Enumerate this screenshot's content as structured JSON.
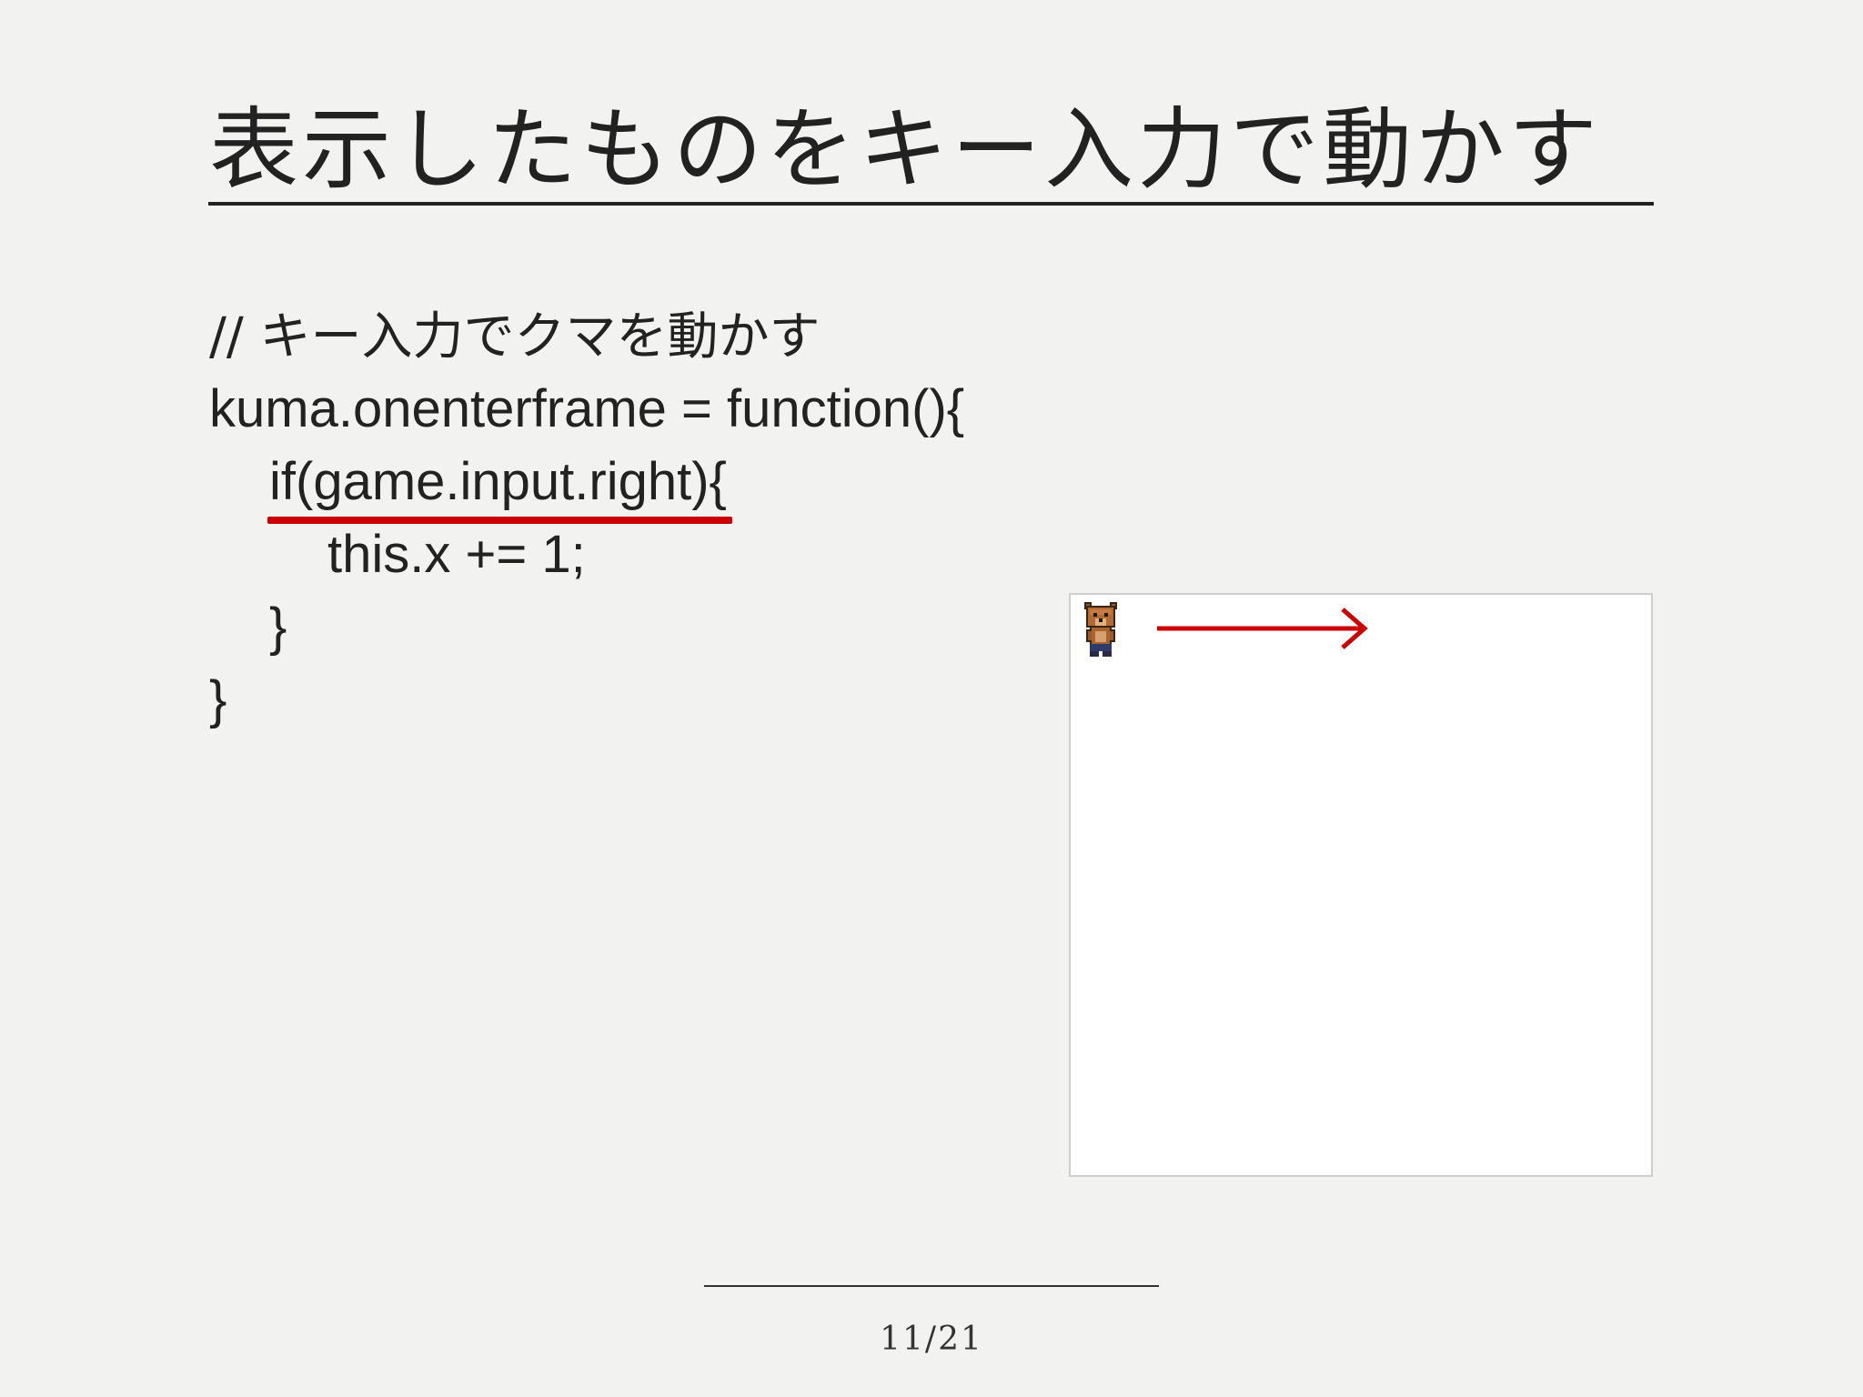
{
  "slide": {
    "title": "表示したものをキー入力で動かす",
    "page_number": "11/21"
  },
  "code": {
    "lines": [
      "// キー入力でクマを動かす",
      "kuma.onenterframe = function(){",
      "if(game.input.right){",
      "this.x += 1;",
      "}",
      "}"
    ]
  },
  "preview": {
    "character_icon": "bear-sprite",
    "direction_icon": "right-arrow",
    "arrow_color": "#cc0000",
    "canvas_color": "#ffffff"
  },
  "colors": {
    "background": "#f2f2f0",
    "text": "#222222",
    "highlight": "#cc0000"
  }
}
